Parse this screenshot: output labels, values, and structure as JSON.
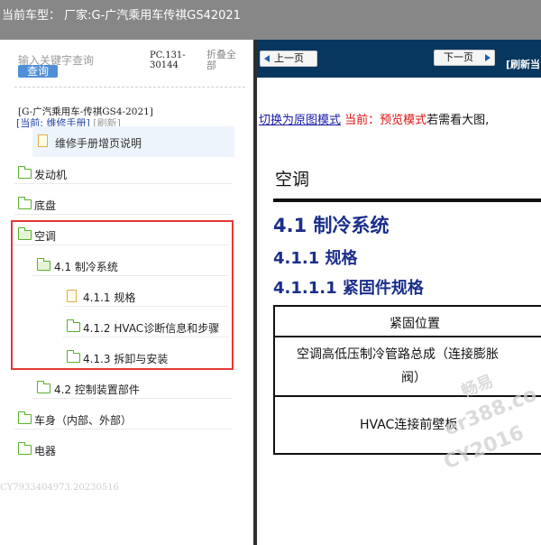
{
  "window": {
    "title": "当前车型：  厂家:G-广汽乘用车传祺GS42021"
  },
  "sidebar": {
    "search_placeholder": "输入关键字查询",
    "search_button": "查询",
    "pc_code": "PC.131-30144",
    "collapse_all": "折叠全部",
    "model": "[G-广汽乘用车-传祺GS4-2021]",
    "current_label": "[当前: 维修手册]",
    "refresh_label": "[刷新]",
    "doc_item": "维修手册增页说明",
    "tree": [
      {
        "label": "发动机"
      },
      {
        "label": "底盘"
      },
      {
        "label": "空调"
      },
      {
        "label": "4.1 制冷系统"
      },
      {
        "label": "4.1.1 规格"
      },
      {
        "label": "4.1.2 HVAC诊断信息和步骤"
      },
      {
        "label": "4.1.3 拆卸与安装"
      },
      {
        "label": "4.2 控制装置部件"
      },
      {
        "label": "车身（内部、外部）"
      },
      {
        "label": "电器"
      }
    ],
    "footer_id": "CY7933404973.20230516",
    "highlight_color": "#e53935"
  },
  "toolbar": {
    "prev_label": "上一页",
    "next_label": "下一页",
    "refresh_label": "[刷新当"
  },
  "content": {
    "mode_switch": "切换为原图模式",
    "mode_current": " 当前：预览模式",
    "mode_hint": "若需看大图,",
    "h1": "空调",
    "h2": "4.1 制冷系统",
    "h3": "4.1.1 规格",
    "h4": "4.1.1.1 紧固件规格",
    "table": {
      "header": "紧固位置",
      "row1_line1": "空调高低压制冷管路总成（连接膨胀",
      "row1_line2": "阀）",
      "row2": "HVAC连接前壁板"
    },
    "watermarks": [
      "畅易",
      "er388.co",
      "CY2016"
    ]
  }
}
